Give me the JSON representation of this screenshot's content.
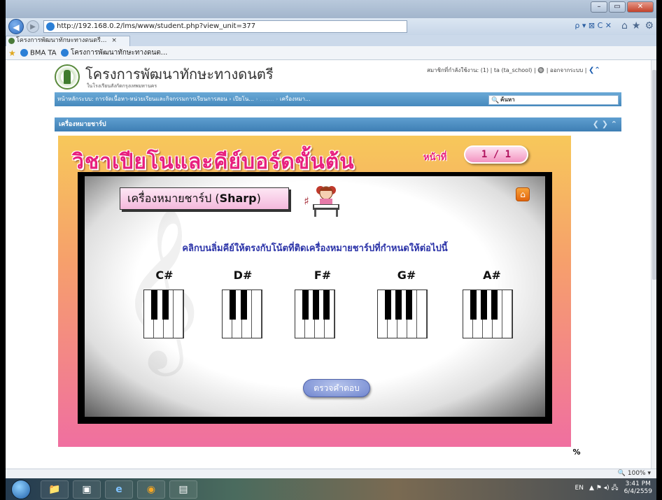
{
  "browser": {
    "url": "http://192.168.0.2/lms/www/student.php?view_unit=377",
    "tab_label": "โครงการพัฒนาทักษะทางดนตรี...",
    "tab_close": "×",
    "address_tools": "ρ ▾ ⊠ C ✕",
    "favorites": [
      "BMA TA",
      "โครงการพัฒนาทักษะทางดนต..."
    ],
    "win_controls": {
      "minimize": "–",
      "maximize": "▭",
      "close": "✕"
    },
    "nav_icons": [
      "⌂",
      "★",
      "⚙"
    ]
  },
  "site": {
    "title": "โครงการพัฒนาทักษะทางดนตรี",
    "subtitle": "ในโรงเรียนสังกัดกรุงเทพมหานคร",
    "user_info": "สมาชิกที่กำลังใช้งาน: (1) | ta (ta_school) | 🔘 | ออกจากระบบ |",
    "menu": "หน้าหลักระบบ: การจัดเนื้อหา-หน่วยเรียนและกิจกรรมการเรียนการสอน › เปียโน...",
    "menu_dim": " › ........ › ",
    "menu_tail": "เครื่องหมา...",
    "search_placeholder": "ค้นหา",
    "unit_title": "เครื่องหมายชาร์ป",
    "unit_arrows": "❮ ❯ ⌃"
  },
  "lesson": {
    "title": "วิชาเปียโนและคีย์บอร์ดขั้นต้น",
    "page_label": "หน้าที่",
    "page_value": "1 / 1",
    "card_title_th": "เครื่องหมายชาร์ป (",
    "card_title_en": "Sharp",
    "card_title_end": ")",
    "sharp_symbol": "♯",
    "clef_symbol": "𝄞",
    "instruction": "คลิกบนลิ่มคีย์ให้ตรงกับโน้ตที่ติดเครื่องหมายชาร์ปที่กำหนดให้ต่อไปนี้",
    "notes": [
      "C#",
      "D#",
      "F#",
      "G#",
      "A#"
    ],
    "check_button": "ตรวจคำตอบ",
    "home_icon": "⌂",
    "corner_icon": "%"
  },
  "status": {
    "zoom": "🔍 100% ▾"
  },
  "taskbar": {
    "items": [
      "📁",
      "▣",
      "e",
      "◉",
      "▤"
    ],
    "lang": "EN",
    "tray": "▲ ⚑ ◂) 🖧",
    "time": "3:41 PM",
    "date": "6/4/2559"
  }
}
